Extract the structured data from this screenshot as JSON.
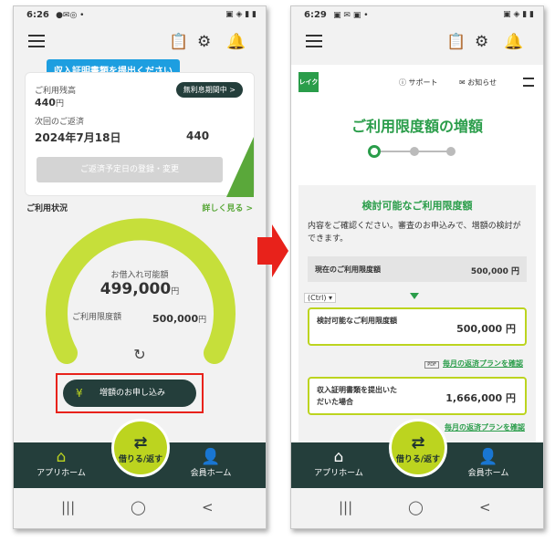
{
  "left": {
    "status": {
      "time": "6:26",
      "icons": "●✉◎ •",
      "right": "▣ ◈ ▮ ▮"
    },
    "tooltip": "収入証明書類を提出ください",
    "card": {
      "balance_label": "ご利用残高",
      "balance": "440",
      "yen": "円",
      "free_label": "無利息期間中 >",
      "next_label": "次回のご返済",
      "next_date": "2024年7月18日",
      "next_amount": "440",
      "register_btn": "ご返済予定日の登録・変更"
    },
    "usage": {
      "title": "ご利用状況",
      "more": "詳しく見る >",
      "available_label": "お借入れ可能額",
      "available": "499,000",
      "available_unit": "円",
      "limit_label": "ご利用限度額",
      "limit": "500,000",
      "limit_unit": "円",
      "refresh": "↻"
    },
    "increase_btn": "増額のお申し込み",
    "increase_icon": "¥",
    "nav": {
      "home": "アプリホーム",
      "fab": "借りる/返す",
      "member": "会員ホーム"
    },
    "sys": [
      "|||",
      "◯",
      "<"
    ]
  },
  "right": {
    "status": {
      "time": "6:29",
      "icons": "▣ ✉ ▣ •",
      "right": "▣ ◈ ▮ ▮"
    },
    "logo": "レイク",
    "support": "サポート",
    "notice": "お知らせ",
    "title": "ご利用限度額の増額",
    "card_title": "検討可能なご利用限度額",
    "desc": "内容をご確認ください。審査のお申込みで、増額の検討ができます。",
    "current_label": "現在のご利用限度額",
    "current_value": "500,000 円",
    "ctrl": "(Ctrl) ▾",
    "box1_label": "検討可能なご利用限度額",
    "box1_value": "500,000 円",
    "pdf": "PDF",
    "plan_link": "毎月の返済プランを確認",
    "box2_label": "収入証明書類を提出いただいた場合",
    "box2_value": "1,666,000 円",
    "bottom_link": "毎月の返済プランを確認",
    "nav": {
      "home": "アプリホーム",
      "fab": "借りる/返す",
      "member": "会員ホーム"
    },
    "sys": [
      "|||",
      "◯",
      "<"
    ]
  },
  "colors": {
    "accent": "#bcd41f",
    "nav": "#243e3b",
    "green": "#2a9d4a",
    "tooltip": "#1d9ee0",
    "highlight": "#e8221b"
  },
  "gauge": {
    "available": 499000,
    "limit": 500000
  }
}
